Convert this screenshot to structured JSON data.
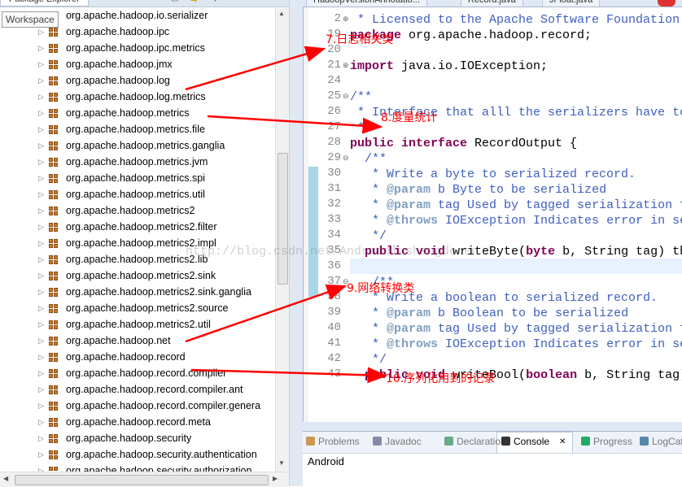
{
  "left_panel": {
    "tab_title": "Package Explorer",
    "tooltip": "Workspace",
    "packages": [
      {
        "name": "org.apache.hadoop.io.serializer",
        "icon": "package-icon"
      },
      {
        "name": "org.apache.hadoop.ipc",
        "icon": "package-icon"
      },
      {
        "name": "org.apache.hadoop.ipc.metrics",
        "icon": "package-icon"
      },
      {
        "name": "org.apache.hadoop.jmx",
        "icon": "package-icon"
      },
      {
        "name": "org.apache.hadoop.log",
        "icon": "package-icon"
      },
      {
        "name": "org.apache.hadoop.log.metrics",
        "icon": "package-icon"
      },
      {
        "name": "org.apache.hadoop.metrics",
        "icon": "package-icon"
      },
      {
        "name": "org.apache.hadoop.metrics.file",
        "icon": "package-icon"
      },
      {
        "name": "org.apache.hadoop.metrics.ganglia",
        "icon": "package-icon"
      },
      {
        "name": "org.apache.hadoop.metrics.jvm",
        "icon": "package-icon"
      },
      {
        "name": "org.apache.hadoop.metrics.spi",
        "icon": "package-icon"
      },
      {
        "name": "org.apache.hadoop.metrics.util",
        "icon": "package-icon"
      },
      {
        "name": "org.apache.hadoop.metrics2",
        "icon": "package-icon"
      },
      {
        "name": "org.apache.hadoop.metrics2.filter",
        "icon": "package-icon"
      },
      {
        "name": "org.apache.hadoop.metrics2.impl",
        "icon": "package-icon"
      },
      {
        "name": "org.apache.hadoop.metrics2.lib",
        "icon": "package-icon"
      },
      {
        "name": "org.apache.hadoop.metrics2.sink",
        "icon": "package-icon"
      },
      {
        "name": "org.apache.hadoop.metrics2.sink.ganglia",
        "icon": "package-icon"
      },
      {
        "name": "org.apache.hadoop.metrics2.source",
        "icon": "package-icon"
      },
      {
        "name": "org.apache.hadoop.metrics2.util",
        "icon": "package-icon"
      },
      {
        "name": "org.apache.hadoop.net",
        "icon": "package-icon"
      },
      {
        "name": "org.apache.hadoop.record",
        "icon": "package-icon"
      },
      {
        "name": "org.apache.hadoop.record.compiler",
        "icon": "package-icon"
      },
      {
        "name": "org.apache.hadoop.record.compiler.ant",
        "icon": "package-icon"
      },
      {
        "name": "org.apache.hadoop.record.compiler.genera",
        "icon": "package-icon"
      },
      {
        "name": "org.apache.hadoop.record.meta",
        "icon": "package-icon"
      },
      {
        "name": "org.apache.hadoop.security",
        "icon": "package-icon"
      },
      {
        "name": "org.apache.hadoop.security.authentication",
        "icon": "package-icon"
      },
      {
        "name": "org.apache.hadoop.security.authorization",
        "icon": "package-icon"
      }
    ]
  },
  "editor": {
    "tabs": [
      "HadoopVersionAnnotatio...",
      "Record.java",
      "JFloat.java"
    ],
    "lines": [
      {
        "n": "2",
        "fold": "plus",
        "parts": [
          {
            "c": "cm",
            "t": " * Licensed to the Apache Software Foundation"
          }
        ]
      },
      {
        "n": "19",
        "fold": "",
        "parts": [
          {
            "c": "kw",
            "t": "package"
          },
          {
            "c": "tx",
            "t": " org.apache.hadoop.record;"
          }
        ]
      },
      {
        "n": "20",
        "fold": "",
        "parts": []
      },
      {
        "n": "21",
        "fold": "plus",
        "parts": [
          {
            "c": "kw",
            "t": "import"
          },
          {
            "c": "tx",
            "t": " java.io.IOException;"
          }
        ]
      },
      {
        "n": "24",
        "fold": "",
        "parts": []
      },
      {
        "n": "25",
        "fold": "minus",
        "parts": [
          {
            "c": "cm",
            "t": "/**"
          }
        ]
      },
      {
        "n": "26",
        "fold": "",
        "parts": [
          {
            "c": "cm",
            "t": " * Interface that alll the serializers have to"
          }
        ]
      },
      {
        "n": "27",
        "fold": "",
        "parts": [
          {
            "c": "cm",
            "t": " */"
          }
        ]
      },
      {
        "n": "28",
        "fold": "",
        "parts": [
          {
            "c": "kw",
            "t": "public interface"
          },
          {
            "c": "tx",
            "t": " RecordOutput {"
          }
        ]
      },
      {
        "n": "29",
        "fold": "minus",
        "parts": [
          {
            "c": "cm",
            "t": "  /**"
          }
        ]
      },
      {
        "n": "30",
        "fold": "",
        "parts": [
          {
            "c": "cm",
            "t": "   * Write a byte to serialized record."
          }
        ]
      },
      {
        "n": "31",
        "fold": "",
        "parts": [
          {
            "c": "cm",
            "t": "   * "
          },
          {
            "c": "jt",
            "t": "@param"
          },
          {
            "c": "cm",
            "t": " b Byte to be serialized"
          }
        ]
      },
      {
        "n": "32",
        "fold": "",
        "parts": [
          {
            "c": "cm",
            "t": "   * "
          },
          {
            "c": "jt",
            "t": "@param"
          },
          {
            "c": "cm",
            "t": " tag Used by tagged serialization f"
          }
        ]
      },
      {
        "n": "33",
        "fold": "",
        "parts": [
          {
            "c": "cm",
            "t": "   * "
          },
          {
            "c": "jt",
            "t": "@throws"
          },
          {
            "c": "cm",
            "t": " IOException Indicates error in se"
          }
        ]
      },
      {
        "n": "34",
        "fold": "",
        "parts": [
          {
            "c": "cm",
            "t": "   */"
          }
        ]
      },
      {
        "n": "35",
        "fold": "",
        "parts": [
          {
            "c": "kw",
            "t": "  public void"
          },
          {
            "c": "tx",
            "t": " writeByte("
          },
          {
            "c": "kw",
            "t": "byte"
          },
          {
            "c": "tx",
            "t": " b, String tag) th"
          }
        ]
      },
      {
        "n": "36",
        "fold": "",
        "parts": []
      },
      {
        "n": "37",
        "fold": "minus",
        "parts": [
          {
            "c": "cm",
            "t": "   /**"
          }
        ]
      },
      {
        "n": "38",
        "fold": "",
        "parts": [
          {
            "c": "cm",
            "t": "   * Write a boolean to serialized record."
          }
        ]
      },
      {
        "n": "39",
        "fold": "",
        "parts": [
          {
            "c": "cm",
            "t": "   * "
          },
          {
            "c": "jt",
            "t": "@param"
          },
          {
            "c": "cm",
            "t": " b Boolean to be serialized"
          }
        ]
      },
      {
        "n": "40",
        "fold": "",
        "parts": [
          {
            "c": "cm",
            "t": "   * "
          },
          {
            "c": "jt",
            "t": "@param"
          },
          {
            "c": "cm",
            "t": " tag Used by tagged serialization f"
          }
        ]
      },
      {
        "n": "41",
        "fold": "",
        "parts": [
          {
            "c": "cm",
            "t": "   * "
          },
          {
            "c": "jt",
            "t": "@throws"
          },
          {
            "c": "cm",
            "t": " IOException Indicates error in se"
          }
        ]
      },
      {
        "n": "42",
        "fold": "",
        "parts": [
          {
            "c": "cm",
            "t": "   */"
          }
        ]
      },
      {
        "n": "43",
        "fold": "",
        "parts": [
          {
            "c": "kw",
            "t": "  public void"
          },
          {
            "c": "tx",
            "t": " writeBool("
          },
          {
            "c": "kw",
            "t": "boolean"
          },
          {
            "c": "tx",
            "t": " b, String tag)"
          }
        ]
      }
    ]
  },
  "bottom_panel": {
    "tabs": [
      {
        "label": "Problems",
        "icon": "problems-icon",
        "active": false
      },
      {
        "label": "Javadoc",
        "icon": "javadoc-icon",
        "active": false
      },
      {
        "label": "Declaration",
        "icon": "declaration-icon",
        "active": false
      },
      {
        "label": "Console",
        "icon": "console-icon",
        "active": true
      },
      {
        "label": "Progress",
        "icon": "progress-icon",
        "active": false
      },
      {
        "label": "LogCat",
        "icon": "logcat-icon",
        "active": false
      }
    ],
    "console_text": "Android"
  },
  "annotations": [
    {
      "text": "7.日志相关类"
    },
    {
      "text": "8.度量统计"
    },
    {
      "text": "9.网络转换类"
    },
    {
      "text": "10.序列化用到的记录"
    }
  ],
  "watermark": "http://blog.csdn.net/Androidlushangderen",
  "colors": {
    "annotation": "#ff0000",
    "keyword": "#7f0055",
    "comment": "#3f5fbf",
    "javadoc_tag": "#7f9fbf",
    "selection_background": "#dfe8f3"
  }
}
